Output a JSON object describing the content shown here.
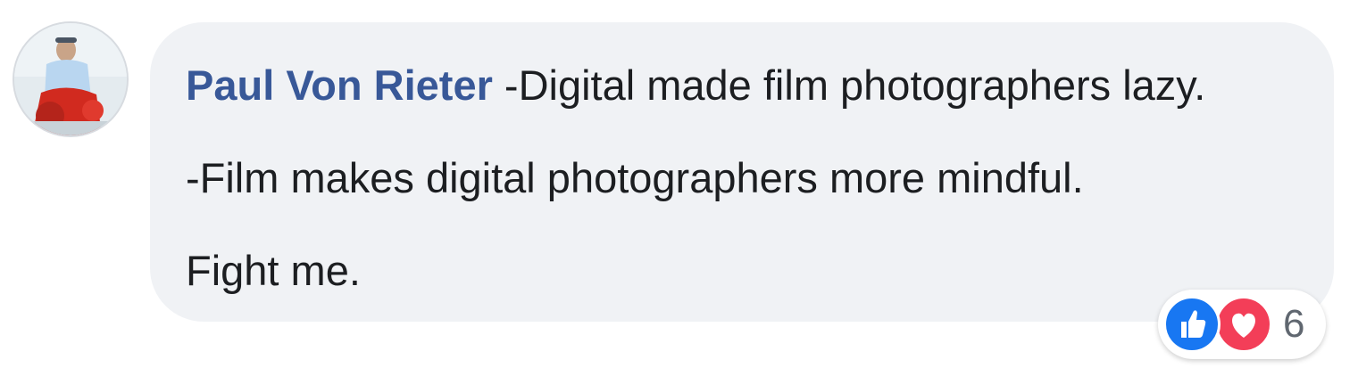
{
  "comment": {
    "author": "Paul Von Rieter",
    "lines": [
      " -Digital made film photographers lazy.",
      "-Film makes digital photographers more mindful.",
      "Fight me."
    ]
  },
  "reactions": {
    "icons": [
      "like-icon",
      "love-icon"
    ],
    "count": "6",
    "colors": {
      "like": "#1877f2",
      "love": "#f33e58"
    }
  },
  "colors": {
    "bubble": "#f0f2f5",
    "author": "#385898",
    "text": "#1c1e21"
  }
}
